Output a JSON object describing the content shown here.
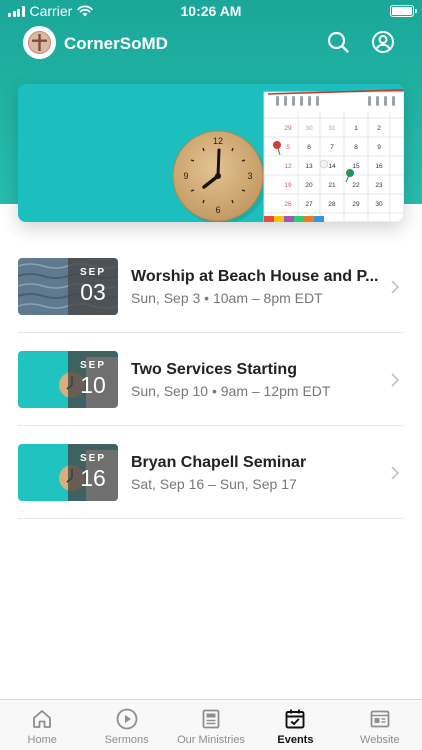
{
  "status_bar": {
    "carrier": "Carrier",
    "time": "10:26 AM"
  },
  "header": {
    "title": "CornerSoMD",
    "icons": [
      "search-icon",
      "account-icon"
    ]
  },
  "hero": {
    "image": "clock-and-calendar-banner"
  },
  "events": [
    {
      "month": "SEP",
      "day": "03",
      "title": "Worship at Beach House and P...",
      "subtitle": "Sun, Sep 3 • 10am – 8pm EDT",
      "thumb": "ocean-water"
    },
    {
      "month": "SEP",
      "day": "10",
      "title": "Two Services Starting",
      "subtitle": "Sun, Sep 10 • 9am – 12pm EDT",
      "thumb": "clock-calendar"
    },
    {
      "month": "SEP",
      "day": "16",
      "title": "Bryan Chapell Seminar",
      "subtitle": "Sat, Sep 16 – Sun, Sep 17",
      "thumb": "clock-calendar"
    }
  ],
  "tabs": [
    {
      "label": "Home",
      "icon": "home-icon",
      "active": false
    },
    {
      "label": "Sermons",
      "icon": "play-icon",
      "active": false
    },
    {
      "label": "Our Ministries",
      "icon": "newspaper-icon",
      "active": false
    },
    {
      "label": "Events",
      "icon": "calendar-icon",
      "active": true
    },
    {
      "label": "Website",
      "icon": "website-icon",
      "active": false
    }
  ],
  "colors": {
    "header": "#22b5a6",
    "active_tab": "#111111",
    "inactive_tab": "#8e8e8e"
  }
}
